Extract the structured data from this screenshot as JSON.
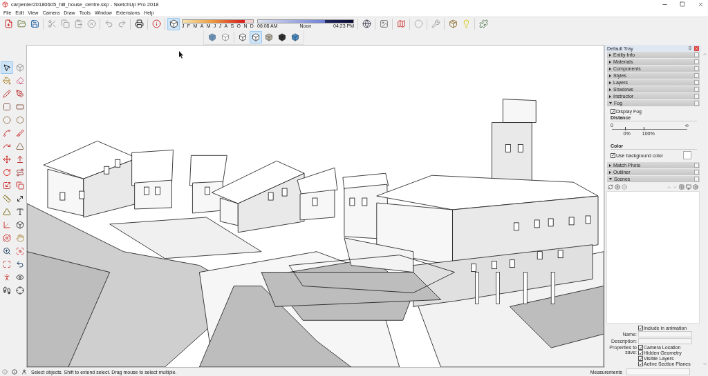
{
  "window": {
    "title": "carpenter20180605_hill_house_centre.skp - SketchUp Pro 2018"
  },
  "menu": [
    "File",
    "Edit",
    "View",
    "Camera",
    "Draw",
    "Tools",
    "Window",
    "Extensions",
    "Help"
  ],
  "main_toolbar": {
    "shadows_toggle": {
      "selected": true
    },
    "date_slider": {
      "level": 0.88
    },
    "time_slider": {
      "level": 0.7
    },
    "months": [
      "J",
      "F",
      "M",
      "A",
      "M",
      "J",
      "J",
      "A",
      "S",
      "O",
      "N",
      "D"
    ],
    "times": [
      "06:08 AM",
      "Noon",
      "04:23 PM"
    ]
  },
  "style_toolbar": [
    {
      "selected": false
    },
    {
      "selected": false
    },
    {
      "selected": false
    },
    {
      "selected": true
    },
    {
      "selected": false
    },
    {
      "selected": false
    },
    {
      "selected": false
    }
  ],
  "tools": [
    {
      "selected": true
    },
    {
      "selected": false
    },
    {
      "selected": false
    },
    {
      "selected": false
    },
    {
      "selected": false
    },
    {
      "selected": false
    },
    {
      "selected": false
    },
    {
      "selected": false
    },
    {
      "selected": false
    },
    {
      "selected": false
    },
    {
      "selected": false
    },
    {
      "selected": false
    },
    {
      "selected": false
    },
    {
      "selected": false
    },
    {
      "selected": false
    },
    {
      "selected": false
    },
    {
      "selected": false
    },
    {
      "selected": false
    },
    {
      "selected": false
    },
    {
      "selected": false
    },
    {
      "selected": false
    },
    {
      "selected": false
    },
    {
      "selected": false
    },
    {
      "selected": false
    },
    {
      "selected": false
    },
    {
      "selected": false
    },
    {
      "selected": false
    },
    {
      "selected": false
    },
    {
      "selected": false
    },
    {
      "selected": false
    },
    {
      "selected": false
    },
    {
      "selected": false
    },
    {
      "selected": false
    },
    {
      "selected": false
    },
    {
      "selected": false
    },
    {
      "selected": false
    }
  ],
  "tray": {
    "title": "Default Tray",
    "panels": [
      {
        "title": "Entity Info",
        "expanded": false
      },
      {
        "title": "Materials",
        "expanded": false
      },
      {
        "title": "Components",
        "expanded": false
      },
      {
        "title": "Styles",
        "expanded": false
      },
      {
        "title": "Layers",
        "expanded": false
      },
      {
        "title": "Shadows",
        "expanded": false
      },
      {
        "title": "Instructor",
        "expanded": false
      },
      {
        "title": "Fog",
        "expanded": true,
        "fog": {
          "display_fog": {
            "label": "Display Fog",
            "checked": true
          },
          "distance_heading": "Distance",
          "scale_labels": [
            "0",
            "∞"
          ],
          "markers": [
            {
              "label": "0%",
              "level": 0.17
            },
            {
              "label": "100%",
              "level": 0.42
            }
          ],
          "color_heading": "Color",
          "use_background": {
            "label": "Use background color",
            "checked": true
          }
        }
      },
      {
        "title": "Match Photo",
        "expanded": false
      },
      {
        "title": "Outliner",
        "expanded": false
      },
      {
        "title": "Scenes",
        "expanded": true,
        "scenes": {
          "include_animation": {
            "label": "Include in animation",
            "checked": true
          },
          "fields": [
            {
              "label": "Name:"
            },
            {
              "label": "Description:"
            }
          ],
          "properties_label": "Properties to save:",
          "properties": [
            {
              "label": "Camera Location",
              "checked": true
            },
            {
              "label": "Hidden Geometry",
              "checked": true
            },
            {
              "label": "Visible Layers",
              "checked": true
            },
            {
              "label": "Active Section Planes",
              "checked": true
            }
          ]
        }
      }
    ]
  },
  "status_bar": {
    "text": "Select objects. Shift to extend select. Drag mouse to select multiple.",
    "measurements_label": "Measurements"
  }
}
